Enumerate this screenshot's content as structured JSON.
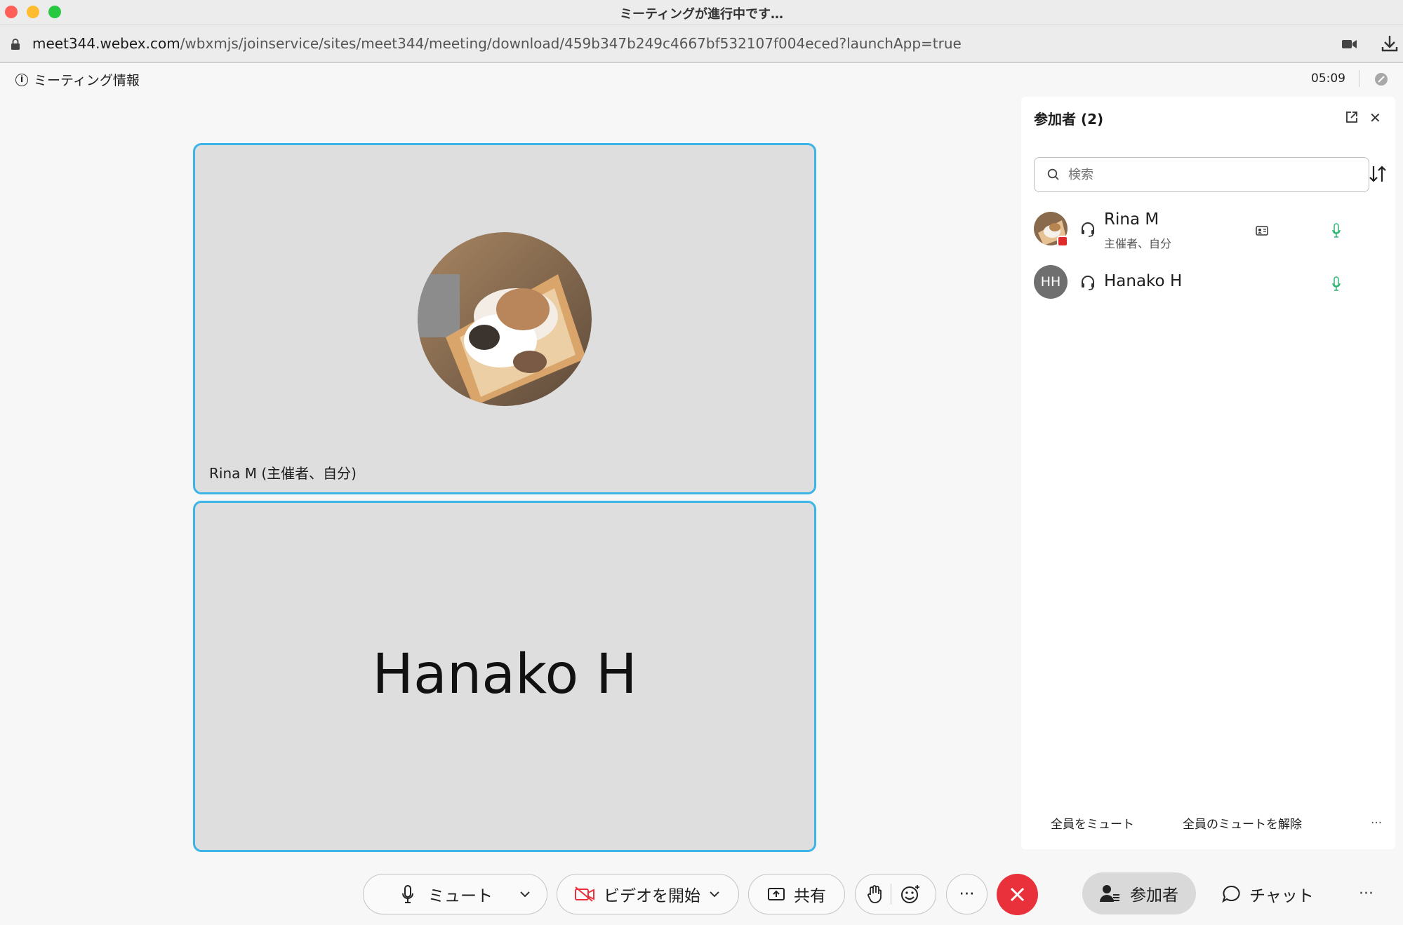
{
  "window": {
    "title": "ミーティングが進行中です…"
  },
  "browser": {
    "url_host": "meet344.webex.com",
    "url_path": "/wbxmjs/joinservice/sites/meet344/meeting/download/459b347b249c4667bf532107f004eced?launchApp=true"
  },
  "header": {
    "meeting_info_label": "ミーティング情報",
    "timer": "05:09"
  },
  "tiles": [
    {
      "label": "Rina M (主催者、自分)"
    },
    {
      "display_name": "Hanako H"
    }
  ],
  "panel": {
    "title": "参加者 (2)",
    "search_placeholder": "検索",
    "participants": [
      {
        "name": "Rina M",
        "role": "主催者、自分"
      },
      {
        "name": "Hanako H",
        "initials": "HH"
      }
    ],
    "mute_all": "全員をミュート",
    "unmute_all": "全員のミュートを解除",
    "more": "..."
  },
  "controls": {
    "mute": "ミュート",
    "video": "ビデオを開始",
    "share": "共有",
    "more": "···",
    "participants": "参加者",
    "chat": "チャット",
    "overflow": "···"
  },
  "colors": {
    "tile_border": "#3cb4e6",
    "leave": "#e8313b",
    "mic_active": "#2bb673"
  }
}
